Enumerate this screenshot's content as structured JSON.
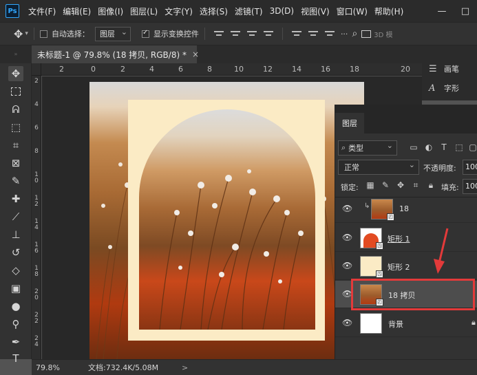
{
  "app": {
    "logo": "Ps",
    "menu": [
      "文件(F)",
      "编辑(E)",
      "图像(I)",
      "图层(L)",
      "文字(Y)",
      "选择(S)",
      "滤镜(T)",
      "3D(D)",
      "视图(V)",
      "窗口(W)",
      "帮助(H)"
    ],
    "window_controls": {
      "minimize": "—",
      "maximize": "□"
    }
  },
  "options_bar": {
    "move_icon": "move-icon",
    "auto_select_label": "自动选择：",
    "auto_select_checked": false,
    "auto_select_target": "图层",
    "show_transform_label": "显示变换控件",
    "show_transform_checked": true,
    "mode_3d_label": "3D 模"
  },
  "document": {
    "tab_title": "未标题-1 @ 79.8% (18 拷贝, RGB/8) *",
    "tab_close": "×"
  },
  "rulers": {
    "top_labels": [
      "2",
      "0",
      "2",
      "4",
      "6",
      "8",
      "10",
      "12",
      "14",
      "16",
      "18",
      "20"
    ],
    "left_labels": [
      "2",
      "4",
      "6",
      "8",
      "1 0",
      "1 2",
      "1 4",
      "1 6",
      "1 8",
      "2 0",
      "2 2",
      "2 4"
    ]
  },
  "right_dock": {
    "items": [
      {
        "icon": "brush-settings-icon",
        "label": "画笔"
      },
      {
        "icon": "character-icon",
        "label": "字形"
      }
    ]
  },
  "layers_panel": {
    "tab": "图层",
    "filter_kind": "类型",
    "blend_mode": "正常",
    "opacity_label": "不透明度:",
    "opacity_value": "100",
    "lock_label": "锁定:",
    "fill_label": "填充:",
    "fill_value": "100",
    "layers": [
      {
        "name": "18",
        "type": "smart-object",
        "clipped": true,
        "visible": true,
        "selected": false
      },
      {
        "name": "矩形 1",
        "type": "shape",
        "clipped": false,
        "visible": true,
        "selected": false
      },
      {
        "name": "矩形 2",
        "type": "shape",
        "clipped": false,
        "visible": true,
        "selected": false
      },
      {
        "name": "18 拷贝",
        "type": "smart-object",
        "clipped": false,
        "visible": true,
        "selected": true
      },
      {
        "name": "背景",
        "type": "background",
        "clipped": false,
        "visible": true,
        "selected": false,
        "locked": true
      }
    ]
  },
  "status_bar": {
    "zoom": "79.8%",
    "doc_info": "文档:732.4K/5.08M",
    "arrow": ">"
  },
  "colors": {
    "highlight": "#e33a3a",
    "frame": "#fbebc5",
    "accent": "#31a8ff"
  }
}
